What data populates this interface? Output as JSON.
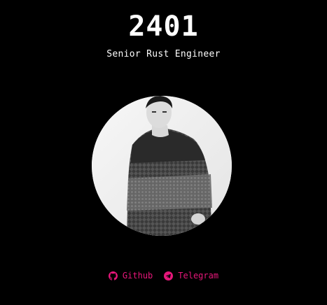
{
  "profile": {
    "name": "2401",
    "role": "Senior Rust Engineer"
  },
  "links": [
    {
      "label": "Github",
      "icon": "github-icon"
    },
    {
      "label": "Telegram",
      "icon": "telegram-icon"
    }
  ],
  "colors": {
    "background": "#000000",
    "text": "#ffffff",
    "accent": "#e6177a"
  }
}
